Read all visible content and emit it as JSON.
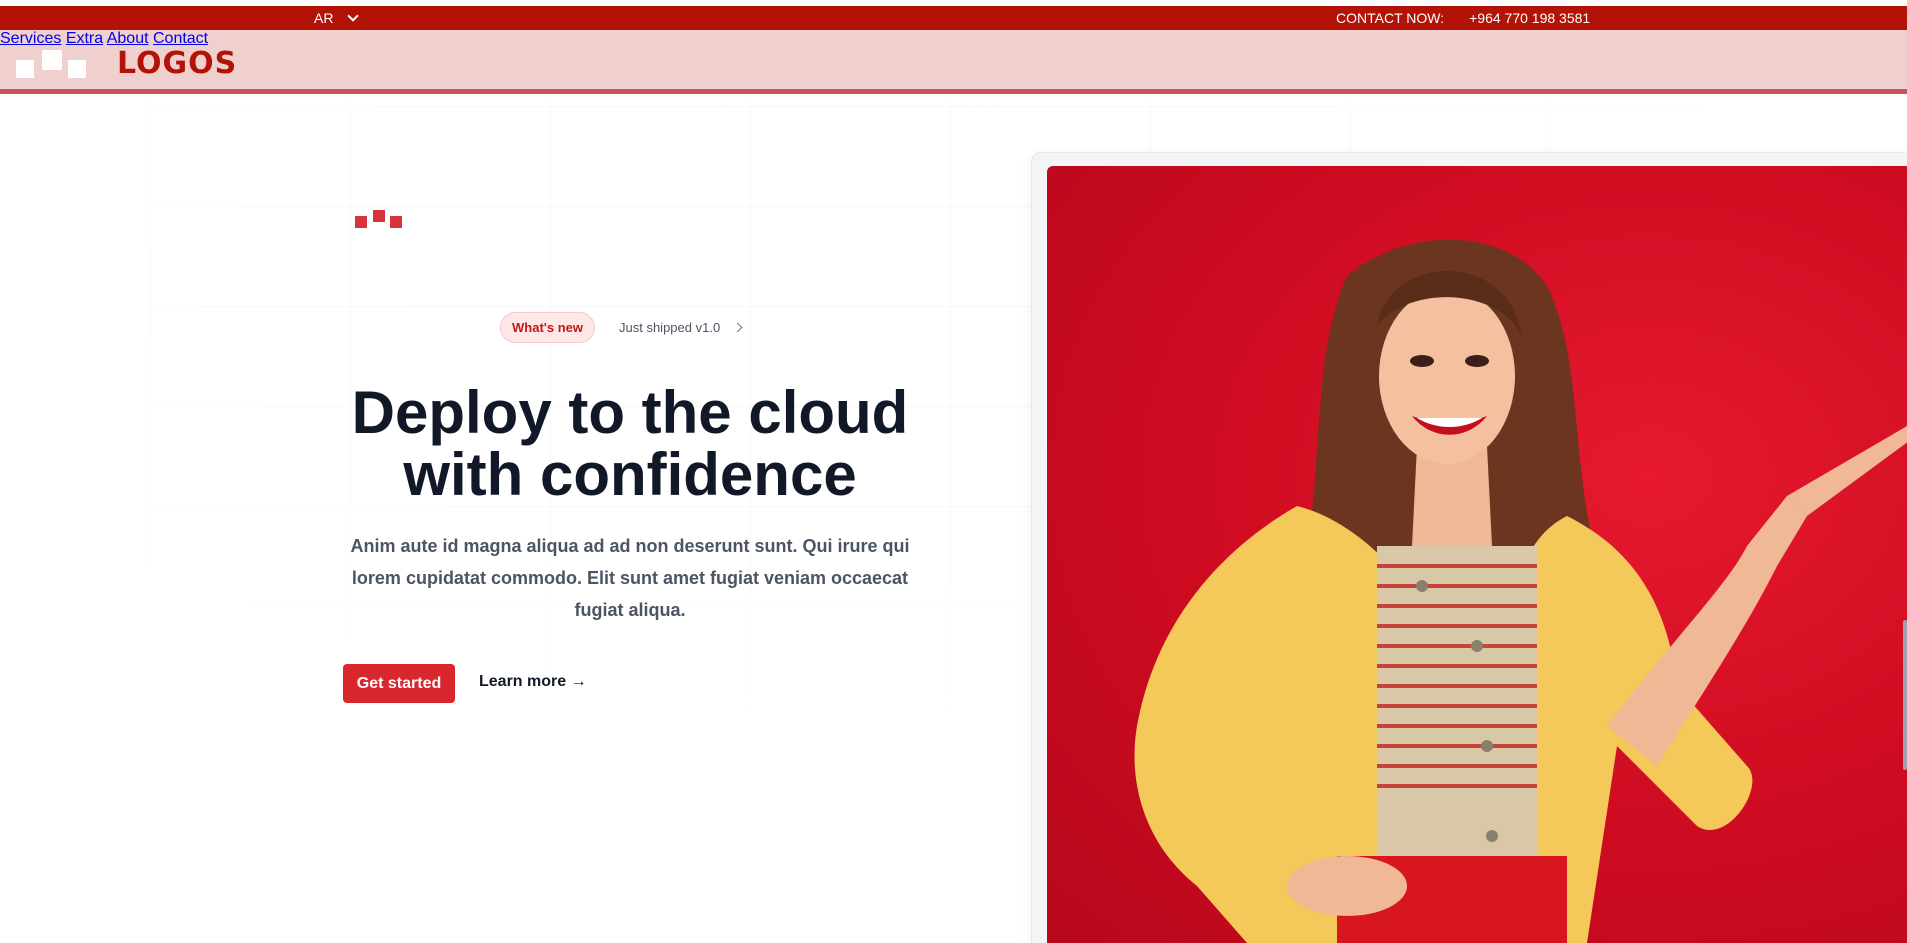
{
  "topbar": {
    "language": "AR",
    "contact_label": "CONTACT NOW:",
    "contact_phone": "+964 770 198 3581"
  },
  "header": {
    "logo_text": "LOGOS",
    "nav": [
      "Services",
      "Extra",
      "About",
      "Contact"
    ]
  },
  "hero": {
    "badge": "What's new",
    "announcement": "Just shipped v1.0",
    "headline_line1": "Deploy to the cloud",
    "headline_line2": "with confidence",
    "description": "Anim aute id magna aliqua ad ad non deserunt sunt. Qui irure qui lorem cupidatat commodo. Elit sunt amet fugiat veniam occaecat fugiat aliqua.",
    "primary_cta": "Get started",
    "secondary_cta": "Learn more →"
  },
  "colors": {
    "brand": "#b31307",
    "accent": "#d9272e",
    "header_bg": "#f0cfcf",
    "photo_bg": "#cd0b20",
    "heading": "#111827"
  },
  "icons": {
    "language_dropdown": "chevron-down-icon",
    "announcement_arrow": "chevron-right-icon",
    "logo": "blocks-logo-icon"
  }
}
